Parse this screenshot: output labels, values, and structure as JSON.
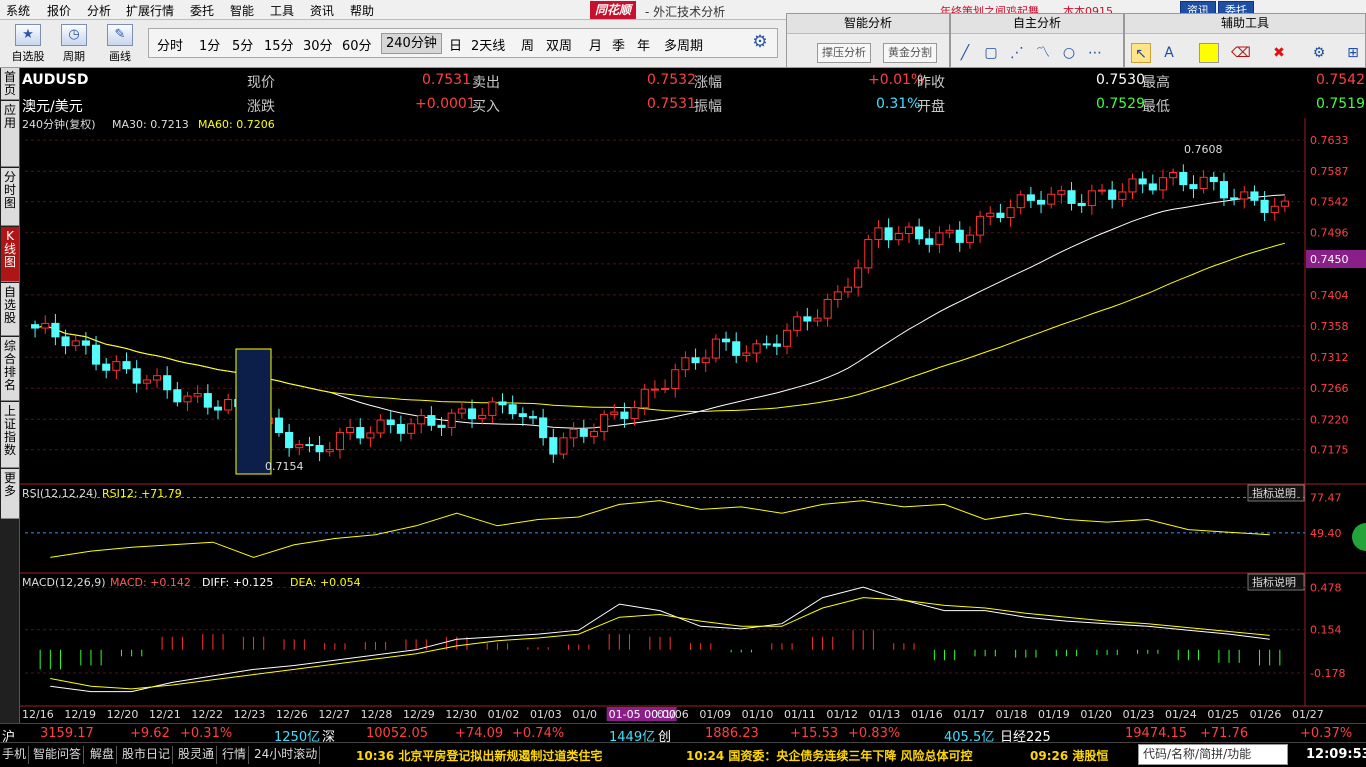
{
  "menu": {
    "items": [
      "系统",
      "报价",
      "分析",
      "扩展行情",
      "委托",
      "智能",
      "工具",
      "资讯",
      "帮助"
    ],
    "logo": "同花顺",
    "title": "- 外汇技术分析",
    "promo": "年终策划之闻鸡起舞",
    "account": "本本0915",
    "btn_news": "资讯",
    "btn_trade": "委托"
  },
  "toolbar": {
    "self_select": "自选股",
    "period": "周期",
    "draw": "画线",
    "periods": [
      "分时",
      "1分",
      "5分",
      "15分",
      "30分",
      "60分",
      "240分钟",
      "日",
      "2天线",
      "周",
      "双周",
      "月",
      "季",
      "年",
      "多周期"
    ],
    "active_period": "240分钟"
  },
  "panels": {
    "smart": "智能分析",
    "smart_btn1": "撑压分析",
    "smart_btn2": "黄金分割",
    "self": "自主分析",
    "aux": "辅助工具"
  },
  "left_tabs": [
    "首页",
    "应用",
    "分时图",
    "K线图",
    "自选股",
    "综合排名",
    "上证指数",
    "更多"
  ],
  "quote": {
    "symbol": "AUDUSD",
    "name": "澳元/美元",
    "sub_title": "240分钟(复权)",
    "ma30": "MA30: 0.7213",
    "ma60": "MA60: 0.7206",
    "labels": {
      "price": "现价",
      "change": "涨跌",
      "sell": "卖出",
      "buy": "买入",
      "pct": "涨幅",
      "amp": "振幅",
      "prev": "昨收",
      "open": "开盘",
      "high": "最高",
      "low": "最低"
    },
    "values": {
      "price": "0.7531",
      "change": "+0.0001",
      "sell": "0.7532",
      "buy": "0.7531",
      "pct": "+0.01%",
      "amp": "0.31%",
      "prev": "0.7530",
      "open": "0.7529",
      "high": "0.7542",
      "low": "0.7519"
    }
  },
  "chart_data": {
    "type": "candlestick",
    "y_ticks": [
      "0.7633",
      "0.7587",
      "0.7542",
      "0.7496",
      "0.7450",
      "0.7404",
      "0.7358",
      "0.7312",
      "0.7266",
      "0.7220",
      "0.7175"
    ],
    "current_level": "0.7450",
    "ylim": [
      0.7145,
      0.7645
    ],
    "annotations": {
      "max": "0.7608",
      "min": "0.7154"
    },
    "x_labels": [
      "12/16",
      "12/19",
      "12/20",
      "12/21",
      "12/22",
      "12/23",
      "12/26",
      "12/27",
      "12/28",
      "12/29",
      "12/30",
      "01/02",
      "01/03",
      "01/0",
      "01-05 00:00",
      "01/06",
      "01/09",
      "01/10",
      "01/11",
      "01/12",
      "01/13",
      "01/16",
      "01/17",
      "01/18",
      "01/19",
      "01/20",
      "01/23",
      "01/24",
      "01/25",
      "01/26",
      "01/27"
    ],
    "closes": [
      0.734,
      0.73,
      0.728,
      0.725,
      0.724,
      0.721,
      0.717,
      0.72,
      0.721,
      0.7215,
      0.723,
      0.724,
      0.718,
      0.721,
      0.724,
      0.729,
      0.733,
      0.732,
      0.736,
      0.74,
      0.75,
      0.749,
      0.749,
      0.753,
      0.755,
      0.7545,
      0.756,
      0.7575,
      0.757,
      0.7545,
      0.7531
    ],
    "rsi": {
      "label": "RSI(12,12,24)",
      "value_label": "RSI12: +71.79",
      "ticks": [
        "77.47",
        "49.40"
      ],
      "values": [
        30,
        35,
        38,
        40,
        42,
        30,
        40,
        45,
        48,
        55,
        65,
        55,
        60,
        62,
        72,
        75,
        68,
        70,
        65,
        72,
        75,
        70,
        72,
        60,
        65,
        60,
        58,
        60,
        52,
        50,
        48
      ]
    },
    "macd": {
      "label": "MACD(12,26,9)",
      "macd_label": "MACD: +0.142",
      "diff_label": "DIFF: +0.125",
      "dea_label": "DEA: +0.054",
      "ticks": [
        "0.478",
        "0.154",
        "-0.178"
      ],
      "hist": [
        -0.15,
        -0.12,
        -0.05,
        0.1,
        0.12,
        0.1,
        0.08,
        0.05,
        0.06,
        0.08,
        0.1,
        0.05,
        0.02,
        0.04,
        0.12,
        0.1,
        0.05,
        -0.02,
        0.05,
        0.1,
        0.15,
        0.05,
        -0.08,
        -0.05,
        -0.06,
        -0.05,
        -0.04,
        -0.03,
        -0.08,
        -0.1,
        -0.12
      ],
      "diff": [
        -0.28,
        -0.32,
        -0.32,
        -0.25,
        -0.2,
        -0.15,
        -0.12,
        -0.08,
        -0.04,
        0.0,
        0.08,
        0.1,
        0.12,
        0.15,
        0.35,
        0.3,
        0.18,
        0.16,
        0.2,
        0.4,
        0.48,
        0.38,
        0.3,
        0.3,
        0.25,
        0.22,
        0.2,
        0.18,
        0.15,
        0.12,
        0.08
      ],
      "dea": [
        -0.22,
        -0.28,
        -0.3,
        -0.27,
        -0.23,
        -0.19,
        -0.15,
        -0.11,
        -0.07,
        -0.03,
        0.03,
        0.07,
        0.09,
        0.12,
        0.25,
        0.27,
        0.22,
        0.18,
        0.18,
        0.32,
        0.4,
        0.38,
        0.34,
        0.32,
        0.28,
        0.25,
        0.22,
        0.2,
        0.17,
        0.14,
        0.11
      ]
    },
    "indicator_btn": "指标说明"
  },
  "status": {
    "sh_label": "沪",
    "sh_val": "3159.17",
    "sh_chg": "+9.62",
    "sh_pct": "+0.31%",
    "sh_amt": "1250亿",
    "sz_label": "深",
    "sz_val": "10052.05",
    "sz_chg": "+74.09",
    "sz_pct": "+0.74%",
    "sz_amt": "1449亿",
    "cy_label": "创",
    "cy_val": "1886.23",
    "cy_chg": "+15.53",
    "cy_pct": "+0.83%",
    "cy_amt": "405.5亿",
    "rj_label": "日经225",
    "rj_val": "19474.15",
    "rj_chg": "+71.76",
    "rj_pct": "+0.37%"
  },
  "bottom": {
    "tabs": [
      "手机",
      "智能问答",
      "解盘",
      "股市日记",
      "股灵通",
      "行情",
      "24小时滚动"
    ],
    "news1": "10:36 北京平房登记拟出新规遏制过道类住宅",
    "news2": "10:24 国资委：央企债务连续三年下降 风险总体可控",
    "news3": "09:26 港股恒",
    "search_placeholder": "代码/名称/简拼/功能",
    "clock": "12:09:53"
  }
}
